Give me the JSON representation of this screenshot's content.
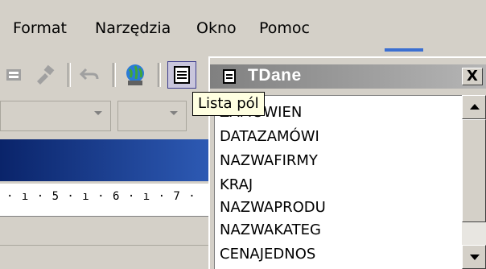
{
  "menubar": {
    "items": [
      {
        "label": "Format"
      },
      {
        "label": "Narzędzia"
      },
      {
        "label": "Okno"
      },
      {
        "label": "Pomoc"
      }
    ]
  },
  "toolbar": {
    "icons": [
      "office-assistant-icon",
      "format-painter-icon",
      "undo-icon",
      "web-globe-icon",
      "field-list-icon"
    ]
  },
  "panel": {
    "title": "TDane",
    "close_label": "X",
    "fields": [
      "ZAMÓWIEN",
      "DATAZAMÓWI",
      "NAZWAFIRMY",
      "KRAJ",
      "NAZWAPRODU",
      "NAZWAKATEG",
      "CENAJEDNOS"
    ]
  },
  "tooltip": {
    "text": "Lista pól"
  },
  "ruler": {
    "text": "· ı · 5 · ı · 6 · ı · 7 ·"
  },
  "colors": {
    "title_active": "#0a246a",
    "title_inactive": "#808080",
    "tooltip_bg": "#ffffe1"
  }
}
